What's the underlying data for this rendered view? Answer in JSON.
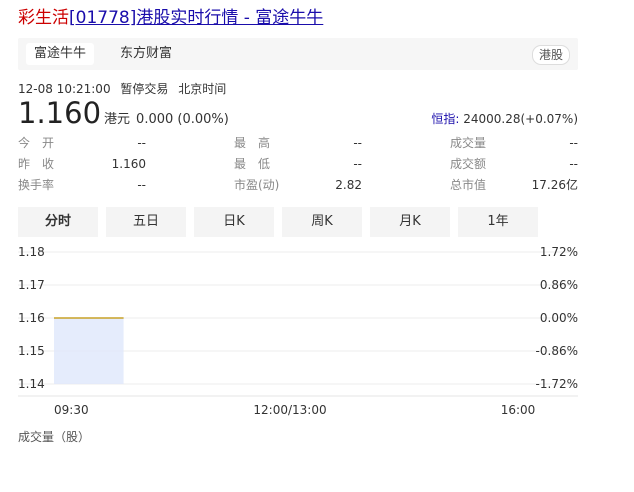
{
  "header": {
    "stock_name": "彩生活",
    "title_rest": "[01778]港股实时行情 - 富途牛牛"
  },
  "source_tabs": [
    {
      "label": "富途牛牛",
      "active": true
    },
    {
      "label": "东方财富",
      "active": false
    }
  ],
  "market_badge": "港股",
  "status": {
    "datetime": "12-08 10:21:00",
    "trading_state": "暂停交易",
    "timezone": "北京时间"
  },
  "quote": {
    "price": "1.160",
    "currency": "港元",
    "change": "0.000 (0.00%)"
  },
  "index": {
    "label": "恒指:",
    "value": "24000.28(+0.07%)"
  },
  "stats": [
    {
      "key": "今　开",
      "value": "--"
    },
    {
      "key": "最　高",
      "value": "--"
    },
    {
      "key": "成交量",
      "value": "--"
    },
    {
      "key": "昨　收",
      "value": "1.160"
    },
    {
      "key": "最　低",
      "value": "--"
    },
    {
      "key": "成交额",
      "value": "--"
    },
    {
      "key": "换手率",
      "value": "--"
    },
    {
      "key": "市盈(动)",
      "value": "2.82"
    },
    {
      "key": "总市值",
      "value": "17.26亿"
    }
  ],
  "period_tabs": [
    {
      "label": "分时",
      "active": true
    },
    {
      "label": "五日",
      "active": false
    },
    {
      "label": "日K",
      "active": false
    },
    {
      "label": "周K",
      "active": false
    },
    {
      "label": "月K",
      "active": false
    },
    {
      "label": "1年",
      "active": false
    }
  ],
  "chart_data": {
    "type": "line",
    "y_ticks": [
      "1.18",
      "1.17",
      "1.16",
      "1.15",
      "1.14"
    ],
    "y_tick_values": [
      1.18,
      1.17,
      1.16,
      1.15,
      1.14
    ],
    "pct_ticks": [
      "1.72%",
      "0.86%",
      "0.00%",
      "-0.86%",
      "-1.72%"
    ],
    "x_ticks": [
      "09:30",
      "12:00/13:00",
      "16:00"
    ],
    "ylim": [
      1.14,
      1.18
    ],
    "series": [
      {
        "values": [
          1.16,
          1.16
        ]
      }
    ],
    "series_fraction_of_day": 0.15,
    "line_color": "#c9a227",
    "fill_color": "#dfe7fb",
    "grid": true
  },
  "volume": {
    "label": "成交量（股）"
  }
}
